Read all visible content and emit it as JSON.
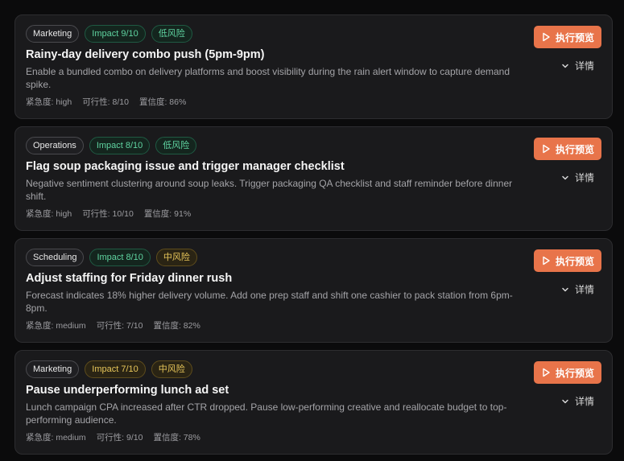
{
  "actions": [
    {
      "category": "Marketing",
      "impact": "Impact 9/10",
      "impact_color": "green",
      "risk": "低风险",
      "risk_color": "green",
      "title": "Rainy-day delivery combo push (5pm-9pm)",
      "description": "Enable a bundled combo on delivery platforms and boost visibility during the rain alert window to capture demand spike.",
      "urgency": "紧急度: high",
      "feasibility": "可行性: 8/10",
      "confidence": "置信度: 86%",
      "run_label": "执行预览",
      "detail_label": "详情"
    },
    {
      "category": "Operations",
      "impact": "Impact 8/10",
      "impact_color": "green",
      "risk": "低风险",
      "risk_color": "green",
      "title": "Flag soup packaging issue and trigger manager checklist",
      "description": "Negative sentiment clustering around soup leaks. Trigger packaging QA checklist and staff reminder before dinner shift.",
      "urgency": "紧急度: high",
      "feasibility": "可行性: 10/10",
      "confidence": "置信度: 91%",
      "run_label": "执行预览",
      "detail_label": "详情"
    },
    {
      "category": "Scheduling",
      "impact": "Impact 8/10",
      "impact_color": "green",
      "risk": "中风险",
      "risk_color": "yellow",
      "title": "Adjust staffing for Friday dinner rush",
      "description": "Forecast indicates 18% higher delivery volume. Add one prep staff and shift one cashier to pack station from 6pm-8pm.",
      "urgency": "紧急度: medium",
      "feasibility": "可行性: 7/10",
      "confidence": "置信度: 82%",
      "run_label": "执行预览",
      "detail_label": "详情"
    },
    {
      "category": "Marketing",
      "impact": "Impact 7/10",
      "impact_color": "yellow",
      "risk": "中风险",
      "risk_color": "yellow",
      "title": "Pause underperforming lunch ad set",
      "description": "Lunch campaign CPA increased after CTR dropped. Pause low-performing creative and reallocate budget to top-performing audience.",
      "urgency": "紧急度: medium",
      "feasibility": "可行性: 9/10",
      "confidence": "置信度: 78%",
      "run_label": "执行预览",
      "detail_label": "详情"
    }
  ],
  "icons": {
    "run": "play-icon",
    "detail": "chevron-down-icon"
  },
  "colors": {
    "accent": "#e8744a",
    "green": "#5fd3a0",
    "yellow": "#e7c65a",
    "card_bg": "#1a1a1c",
    "page_bg": "#0b0b0c"
  }
}
